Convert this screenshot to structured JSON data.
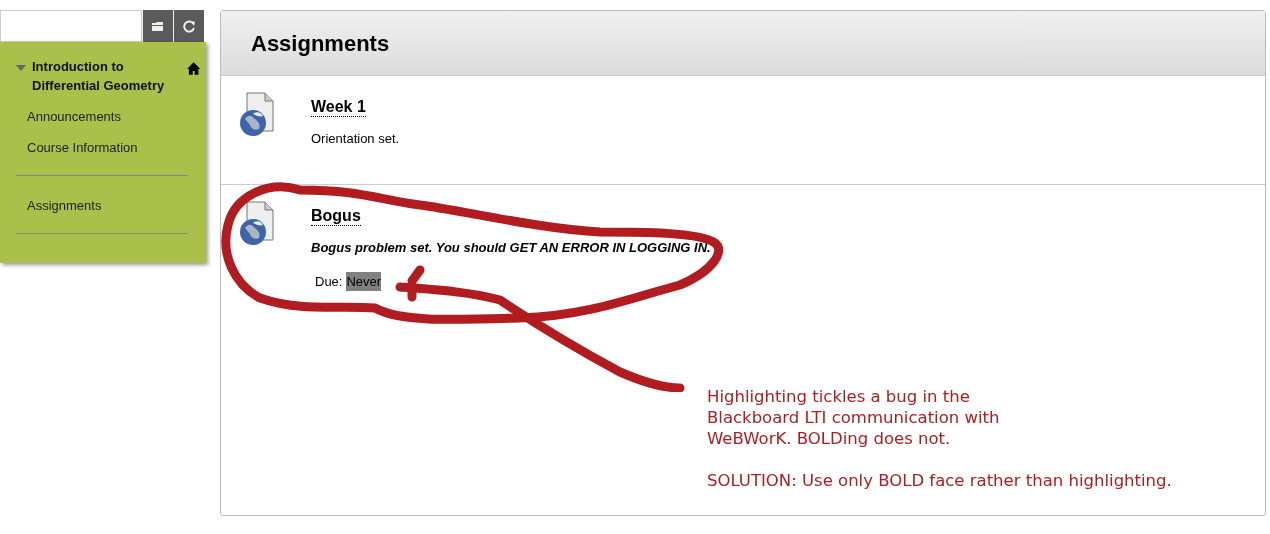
{
  "sidebar": {
    "course": {
      "title": "Introduction to Differential Geometry",
      "expanded": true
    },
    "groups": [
      [
        "Announcements",
        "Course Information"
      ],
      [
        "Assignments"
      ]
    ]
  },
  "content": {
    "title": "Assignments",
    "items": [
      {
        "title": "Week 1",
        "description": "Orientation set.",
        "emphasized": false
      },
      {
        "title": "Bogus",
        "description": "Bogus problem set. You should GET AN ERROR IN LOGGING IN.",
        "emphasized": true,
        "due": {
          "label": "Due:",
          "value": "Never",
          "highlighted": true
        }
      }
    ]
  },
  "annotation": {
    "note_lines": [
      "Highlighting tickles a bug in the",
      "Blackboard LTI communication with",
      "WeBWorK. BOLDing does not."
    ],
    "solution": "SOLUTION: Use only BOLD face rather than highlighting."
  }
}
